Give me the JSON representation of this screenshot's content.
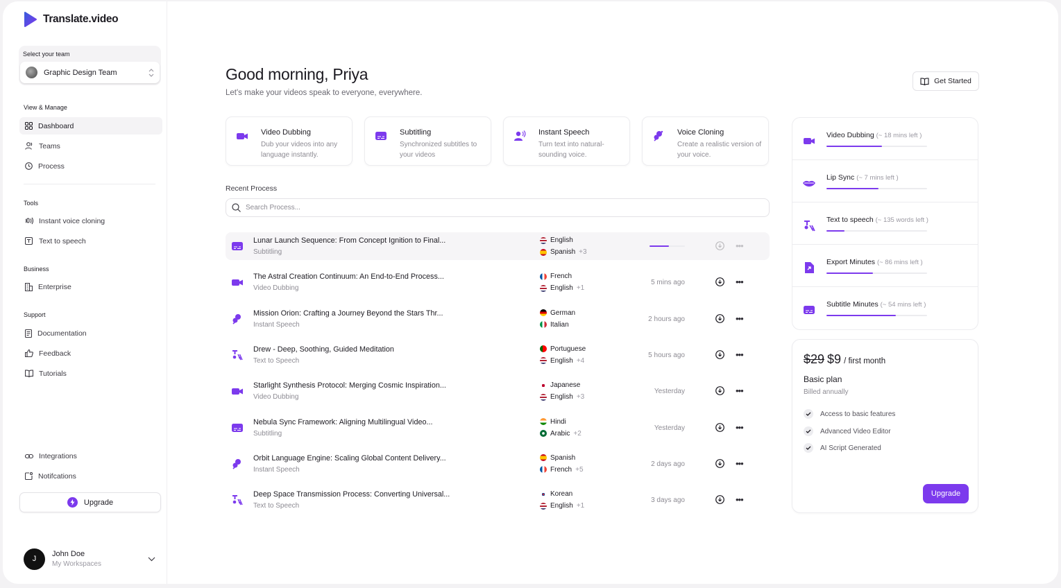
{
  "app": {
    "name": "Translate.video"
  },
  "team": {
    "label": "Select your team",
    "name": "Graphic Design Team"
  },
  "sections": {
    "view": "View & Manage",
    "tools": "Tools",
    "business": "Business",
    "support": "Support"
  },
  "nav": {
    "dashboard": "Dashboard",
    "teams": "Teams",
    "process": "Process",
    "voice_cloning": "Instant voice cloning",
    "tts": "Text to speech",
    "enterprise": "Enterprise",
    "docs": "Documentation",
    "feedback": "Feedback",
    "tutorials": "Tutorials",
    "integrations": "Integrations",
    "notifications": "Notifcations"
  },
  "upgrade_label": "Upgrade",
  "user": {
    "initial": "J",
    "name": "John Doe",
    "sub": "My Workspaces"
  },
  "header": {
    "greeting": "Good morning, Priya",
    "subtitle": "Let's make your videos speak to everyone, everywhere.",
    "get_started": "Get Started"
  },
  "features": [
    {
      "title": "Video Dubbing",
      "desc": "Dub your videos into any language instantly."
    },
    {
      "title": "Subtitling",
      "desc": "Synchronized subtitles to your videos"
    },
    {
      "title": "Instant Speech",
      "desc": "Turn text into natural-sounding voice."
    },
    {
      "title": "Voice Cloning",
      "desc": "Create a realistic version of your voice."
    }
  ],
  "recent": {
    "title": "Recent Process",
    "search_placeholder": "Search Process..."
  },
  "rows": [
    {
      "title": "Lunar Launch Sequence: From Concept Ignition to Final...",
      "type": "Subtitling",
      "lang1": "English",
      "lang2": "Spanish",
      "more": "+3",
      "time": "",
      "progress": 0.55
    },
    {
      "title": "The Astral Creation Continuum: An End-to-End Process...",
      "type": "Video Dubbing",
      "lang1": "French",
      "lang2": "English",
      "more": "+1",
      "time": "5 mins ago"
    },
    {
      "title": "Mission Orion: Crafting a Journey Beyond the Stars Thr...",
      "type": "Instant Speech",
      "lang1": "German",
      "lang2": "Italian",
      "more": "",
      "time": "2 hours ago"
    },
    {
      "title": "Drew - Deep, Soothing, Guided Meditation",
      "type": "Text to Speech",
      "lang1": "Portuguese",
      "lang2": "English",
      "more": "+4",
      "time": "5 hours ago"
    },
    {
      "title": "Starlight Synthesis Protocol: Merging Cosmic Inspiration...",
      "type": "Video Dubbing",
      "lang1": "Japanese",
      "lang2": "English",
      "more": "+3",
      "time": "Yesterday"
    },
    {
      "title": "Nebula Sync Framework: Aligning Multilingual Video...",
      "type": "Subtitling",
      "lang1": "Hindi",
      "lang2": "Arabic",
      "more": "+2",
      "time": "Yesterday"
    },
    {
      "title": "Orbit Language Engine: Scaling Global Content Delivery...",
      "type": "Instant Speech",
      "lang1": "Spanish",
      "lang2": "French",
      "more": "+5",
      "time": "2 days ago"
    },
    {
      "title": "Deep Space Transmission Process: Converting Universal...",
      "type": "Text to Speech",
      "lang1": "Korean",
      "lang2": "English",
      "more": "+1",
      "time": "3 days ago"
    }
  ],
  "usage": [
    {
      "name": "Video Dubbing",
      "left": "(~ 18 mins left )",
      "fill": 0.55
    },
    {
      "name": "Lip Sync",
      "left": "(~ 7 mins left )",
      "fill": 0.52
    },
    {
      "name": "Text to speech",
      "left": "(~ 135 words left )",
      "fill": 0.18
    },
    {
      "name": "Export Minutes",
      "left": "(~ 86 mins left )",
      "fill": 0.46
    },
    {
      "name": "Subtitle Minutes",
      "left": "(~ 54 mins left )",
      "fill": 0.69
    }
  ],
  "plan": {
    "old_price": "$29",
    "new_price": "$9",
    "period": "/ first month",
    "name": "Basic plan",
    "billing": "Billed annually",
    "features": [
      "Access to basic features",
      "Advanced Video Editor",
      "AI Script Generated"
    ],
    "button": "Upgrade"
  },
  "colors": {
    "accent": "#7c3aed"
  }
}
